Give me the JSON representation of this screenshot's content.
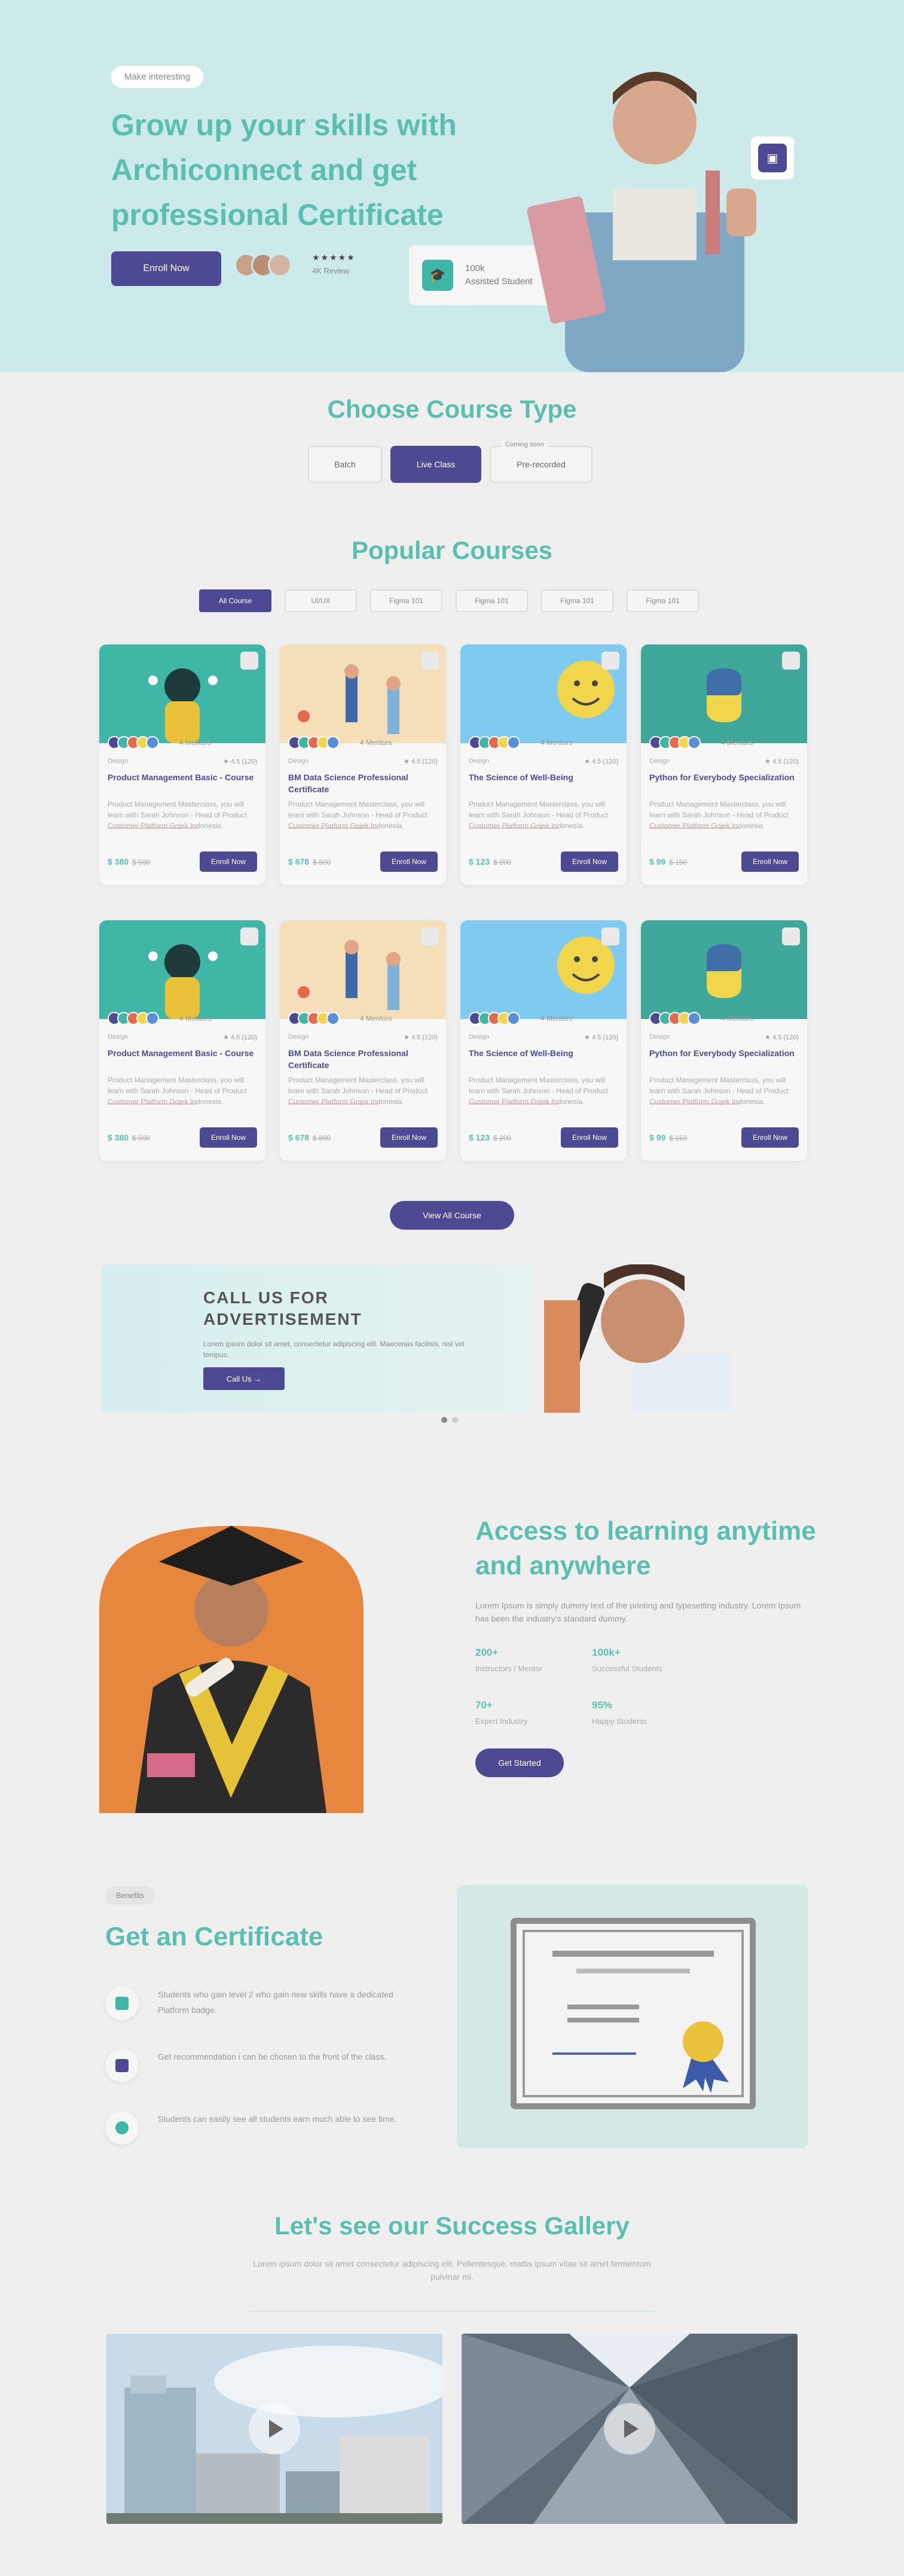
{
  "hero": {
    "pill": "Make interesting",
    "title": "Grow up your skills with Archiconnect and get professional Certificate",
    "enroll_label": "Enroll Now",
    "rating_stars": "★★★★★",
    "rating_text": "4K Review",
    "stat_line1": "100k",
    "stat_line2": "Assisted Student"
  },
  "course_type": {
    "title": "Choose Course Type",
    "options": [
      {
        "label": "Batch",
        "active": false
      },
      {
        "label": "Live Class",
        "active": true
      },
      {
        "label": "Pre-recorded",
        "active": false,
        "tag": "Coming soon"
      }
    ]
  },
  "popular": {
    "title": "Popular Courses",
    "tabs": [
      "All Course",
      "UI/UX",
      "Figma 101",
      "Figma 101",
      "Figma 101",
      "Figma 101"
    ],
    "mentors_label": "4 Mentors",
    "enroll_label": "Enroll Now",
    "courses": [
      {
        "category": "Design",
        "rating": "4.5 (120)",
        "title": "Product Management Basic - Course",
        "desc": "Product Management Masterclass, you will learn with Sarah Johnson - Head of Product Customer Platform Gojek Indonesia.",
        "price": "$ 380",
        "old": "$ 500"
      },
      {
        "category": "Design",
        "rating": "4.5 (120)",
        "title": "BM Data Science Professional Certificate",
        "desc": "Product Management Masterclass, you will learn with Sarah Johnson - Head of Product Customer Platform Gojek Indonesia.",
        "price": "$ 678",
        "old": "$ 800"
      },
      {
        "category": "Design",
        "rating": "4.5 (120)",
        "title": "The Science of Well-Being",
        "desc": "Product Management Masterclass, you will learn with Sarah Johnson - Head of Product Customer Platform Gojek Indonesia.",
        "price": "$ 123",
        "old": "$ 200"
      },
      {
        "category": "Design",
        "rating": "4.5 (120)",
        "title": "Python for Everybody Specialization",
        "desc": "Product Management Masterclass, you will learn with Sarah Johnson - Head of Product Customer Platform Gojek Indonesia.",
        "price": "$ 99",
        "old": "$ 150"
      },
      {
        "category": "Design",
        "rating": "4.5 (120)",
        "title": "Product Management Basic - Course",
        "desc": "Product Management Masterclass, you will learn with Sarah Johnson - Head of Product Customer Platform Gojek Indonesia.",
        "price": "$ 380",
        "old": "$ 500"
      },
      {
        "category": "Design",
        "rating": "4.5 (120)",
        "title": "BM Data Science Professional Certificate",
        "desc": "Product Management Masterclass, you will learn with Sarah Johnson - Head of Product Customer Platform Gojek Indonesia.",
        "price": "$ 678",
        "old": "$ 800"
      },
      {
        "category": "Design",
        "rating": "4.5 (120)",
        "title": "The Science of Well-Being",
        "desc": "Product Management Masterclass, you will learn with Sarah Johnson - Head of Product Customer Platform Gojek Indonesia.",
        "price": "$ 123",
        "old": "$ 200"
      },
      {
        "category": "Design",
        "rating": "4.5 (120)",
        "title": "Python for Everybody Specialization",
        "desc": "Product Management Masterclass, you will learn with Sarah Johnson - Head of Product Customer Platform Gojek Indonesia.",
        "price": "$ 99",
        "old": "$ 150"
      }
    ],
    "view_all": "View All Course"
  },
  "ad": {
    "title": "CALL US FOR ADVERTISEMENT",
    "text": "Lorem ipsum dolor sit amet, consectetur adipiscing elit. Maecenas facilisis, nisl vel tempus.",
    "button": "Call Us →"
  },
  "access": {
    "title": "Access to learning anytime and anywhere",
    "para": "Lorem Ipsum is simply dummy text of the printing and typesetting industry. Lorem Ipsum has been the industry's standard dummy.",
    "stats": [
      {
        "value": "200+",
        "label": "Instructors / Mentor"
      },
      {
        "value": "100k+",
        "label": "Successful Students"
      },
      {
        "value": "70+",
        "label": "Expert Industry"
      },
      {
        "value": "95%",
        "label": "Happy Students"
      }
    ],
    "button": "Get Started"
  },
  "certificate": {
    "pill": "Benefits",
    "title": "Get an Certificate",
    "items": [
      {
        "text": "Students who gain level 2 who gain new skills have a dedicated Platform badge.",
        "color": "#3fb6a6"
      },
      {
        "text": "Get recommendation i can be chosen to the front of the class.",
        "color": "#4e4993"
      },
      {
        "text": "Students can easily see all students earn much able to see time.",
        "color": "#3fb6a6"
      }
    ]
  },
  "gallery": {
    "title": "Let's see our Success Gallery",
    "subtitle": "Lorem ipsum dolor sit amet consectetur adipiscing elit. Pellentesque, mattis ipsum vitae sit amet fermentum pulvinar mi."
  }
}
